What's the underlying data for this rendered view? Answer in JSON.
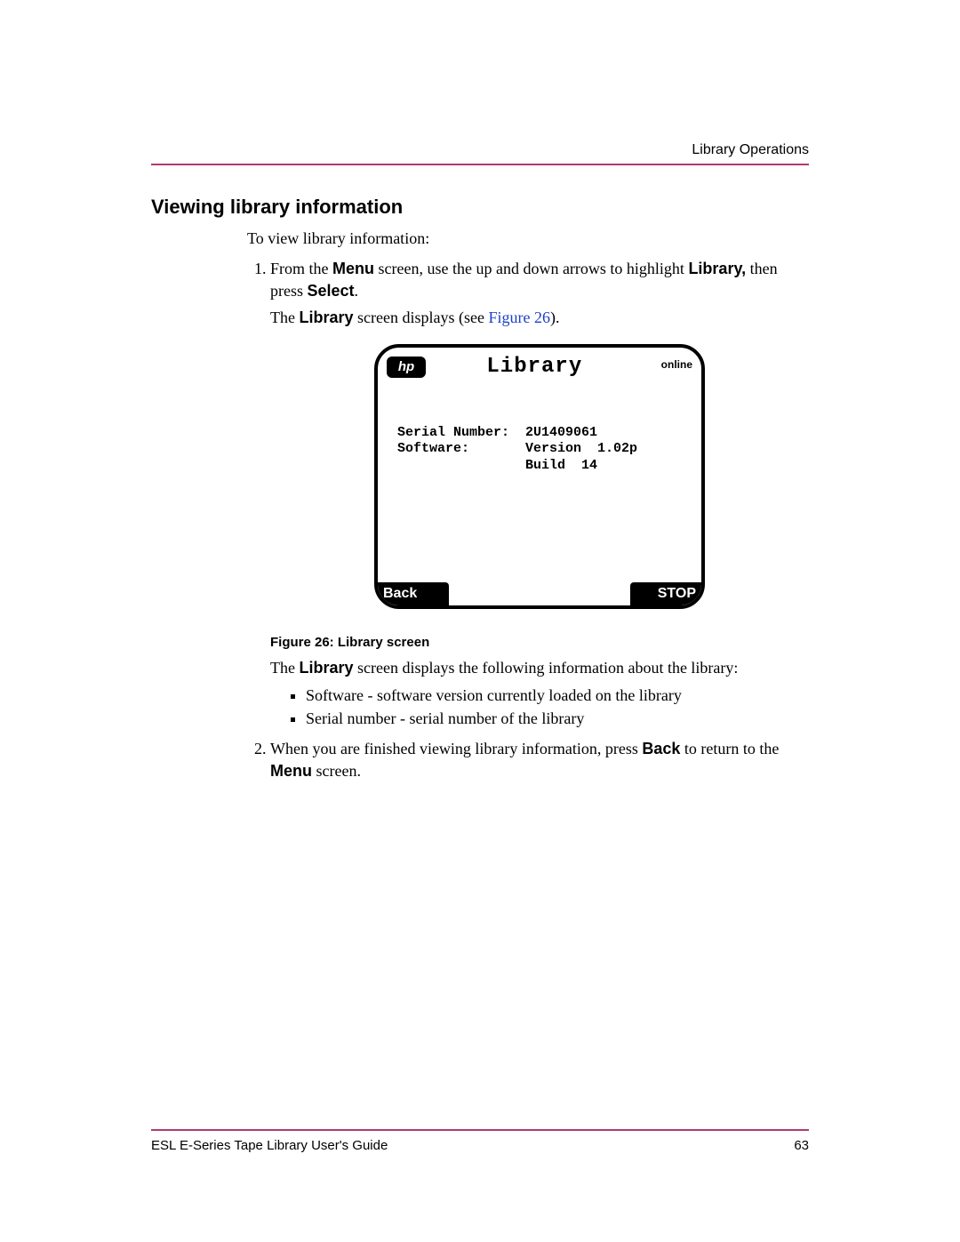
{
  "header": {
    "running_head": "Library Operations"
  },
  "section": {
    "heading": "Viewing library information",
    "intro": "To view library information:",
    "step1_a": "From the ",
    "step1_menu": "Menu",
    "step1_b": " screen, use the up and down arrows to highlight ",
    "step1_library": "Library,",
    "step1_c": " then press ",
    "step1_select": "Select",
    "step1_d": ".",
    "step1_result_a": "The ",
    "step1_result_lib": "Library",
    "step1_result_b": " screen displays (see ",
    "step1_result_link": "Figure 26",
    "step1_result_c": ").",
    "figure_caption": "Figure 26: Library screen",
    "after_fig_a": "The ",
    "after_fig_lib": "Library",
    "after_fig_b": " screen displays the following information about the library:",
    "bullets": [
      "Software - software version currently loaded on the library",
      "Serial number - serial number of the library"
    ],
    "step2_a": "When you are finished viewing library information, press ",
    "step2_back": "Back",
    "step2_b": " to return to the ",
    "step2_menu": "Menu",
    "step2_c": " screen."
  },
  "device": {
    "logo_text": "hp",
    "title": "Library",
    "status": "online",
    "serial_label": "Serial Number:",
    "software_label": "Software:",
    "serial_value": "2U1409061",
    "version_line": "Version  1.02p",
    "build_line": "Build  14",
    "back_btn": "Back",
    "stop_btn": "STOP"
  },
  "footer": {
    "doc_title": "ESL E-Series Tape Library User's Guide",
    "page_number": "63"
  }
}
